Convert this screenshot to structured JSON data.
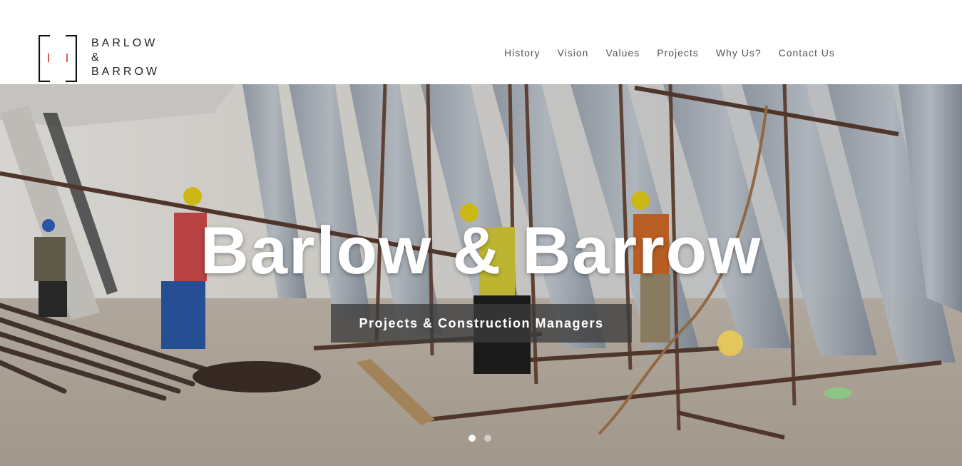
{
  "brand": {
    "line1": "BARLOW",
    "line2": "&",
    "line3": "BARROW",
    "accent_color": "#d0332a"
  },
  "nav": {
    "items": [
      {
        "label": "History"
      },
      {
        "label": "Vision"
      },
      {
        "label": "Values"
      },
      {
        "label": "Projects"
      },
      {
        "label": "Why Us?"
      },
      {
        "label": "Contact Us"
      }
    ]
  },
  "hero": {
    "title": "Barlow & Barrow",
    "subtitle": "Projects & Construction Managers",
    "slides": 2,
    "active_slide": 1
  }
}
